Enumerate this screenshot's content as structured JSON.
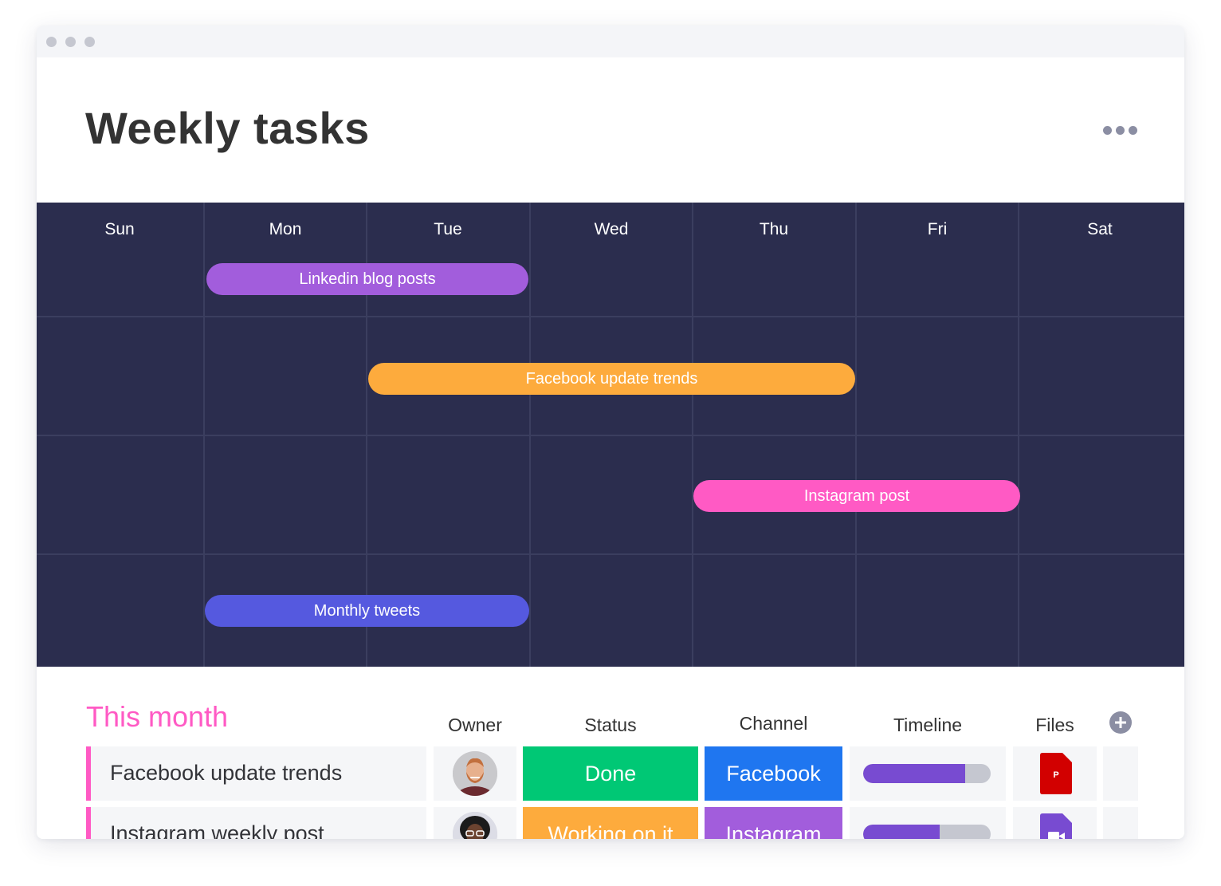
{
  "window": {
    "traffic_lights": [
      "dot",
      "dot",
      "dot"
    ]
  },
  "header": {
    "title": "Weekly tasks",
    "more_icon": "more-horizontal-icon"
  },
  "calendar": {
    "days": [
      "Sun",
      "Mon",
      "Tue",
      "Wed",
      "Thu",
      "Fri",
      "Sat"
    ],
    "tasks": [
      {
        "label": "Linkedin blog posts",
        "start_day": "Mon",
        "end_day": "Tue",
        "color": "#a25ddc"
      },
      {
        "label": "Facebook update trends",
        "start_day": "Tue",
        "end_day": "Thu",
        "color": "#fdab3d"
      },
      {
        "label": "Instagram post",
        "start_day": "Thu",
        "end_day": "Fri",
        "color": "#ff5ac4"
      },
      {
        "label": "Monthly tweets",
        "start_day": "Mon",
        "end_day": "Tue",
        "color": "#5559df"
      }
    ]
  },
  "table": {
    "group_title": "This month",
    "group_color": "#ff5ac4",
    "columns": {
      "owner": "Owner",
      "status": "Status",
      "channel": "Channel",
      "timeline": "Timeline",
      "files": "Files"
    },
    "add_column_icon": "plus-circle-icon",
    "rows": [
      {
        "name": "Facebook update trends",
        "owner_avatar": "avatar-man-beard",
        "status": "Done",
        "status_color": "#00c875",
        "channel": "Facebook",
        "channel_color": "#1f76f0",
        "timeline_progress": 0.8,
        "file_type": "pdf",
        "file_icon": "pdf-file-icon",
        "file_label": "P",
        "file_color": "#d20000"
      },
      {
        "name": "Instagram weekly post",
        "owner_avatar": "avatar-woman-glasses",
        "status": "Working on it",
        "status_color": "#fdab3d",
        "channel": "Instagram",
        "channel_color": "#a25ddc",
        "timeline_progress": 0.6,
        "file_type": "video",
        "file_icon": "video-file-icon",
        "file_label": "",
        "file_color": "#784bd1"
      }
    ]
  }
}
